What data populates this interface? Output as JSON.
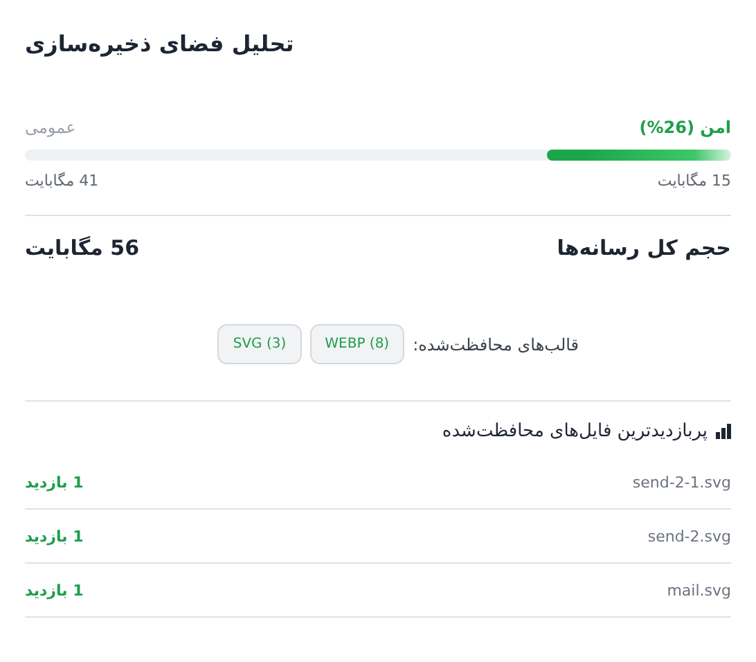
{
  "title": "تحلیل فضای ذخیره‌سازی",
  "usage": {
    "safe_label": "امن (26%)",
    "public_label": "عمومی",
    "level": 0.26,
    "safe_size": "15 مگابایت",
    "public_size": "41 مگابایت"
  },
  "total": {
    "label": "حجم کل رسانه‌ها",
    "value": "56 مگابایت"
  },
  "formats": {
    "label": "قالب‌های محافظت‌شده:",
    "items": [
      "WEBP (8)",
      "SVG (3)"
    ]
  },
  "top_files": {
    "heading": "پربازدیدترین فایل‌های محافظت‌شده",
    "rows": [
      {
        "name": "send-2-1.svg",
        "visits": "1 بازدید"
      },
      {
        "name": "send-2.svg",
        "visits": "1 بازدید"
      },
      {
        "name": "mail.svg",
        "visits": "1 بازدید"
      }
    ]
  }
}
